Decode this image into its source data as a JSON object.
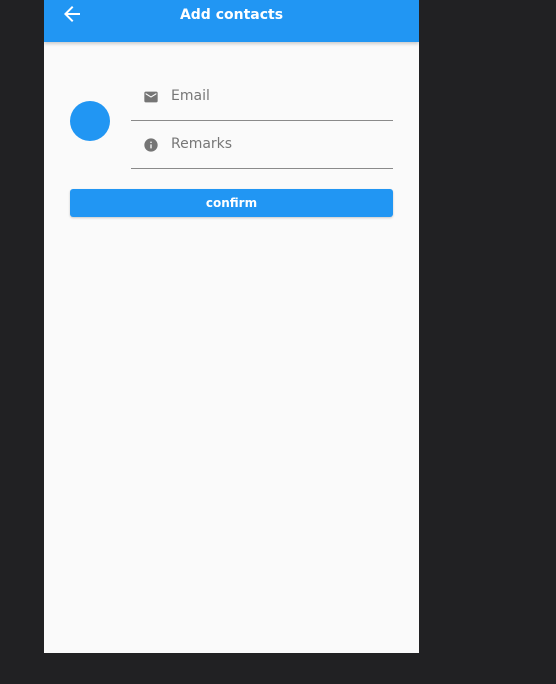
{
  "appbar": {
    "title": "Add contacts",
    "back_icon": "arrow-back-icon",
    "color": "#2196f3"
  },
  "form": {
    "avatar_color": "#2196f3",
    "email": {
      "icon": "mail-icon",
      "placeholder": "Email",
      "value": ""
    },
    "remarks": {
      "icon": "info-icon",
      "placeholder": "Remarks",
      "value": ""
    },
    "confirm_label": "confirm"
  },
  "colors": {
    "outer_background": "#212123",
    "page_background": "#fafafa",
    "accent": "#2196f3"
  }
}
